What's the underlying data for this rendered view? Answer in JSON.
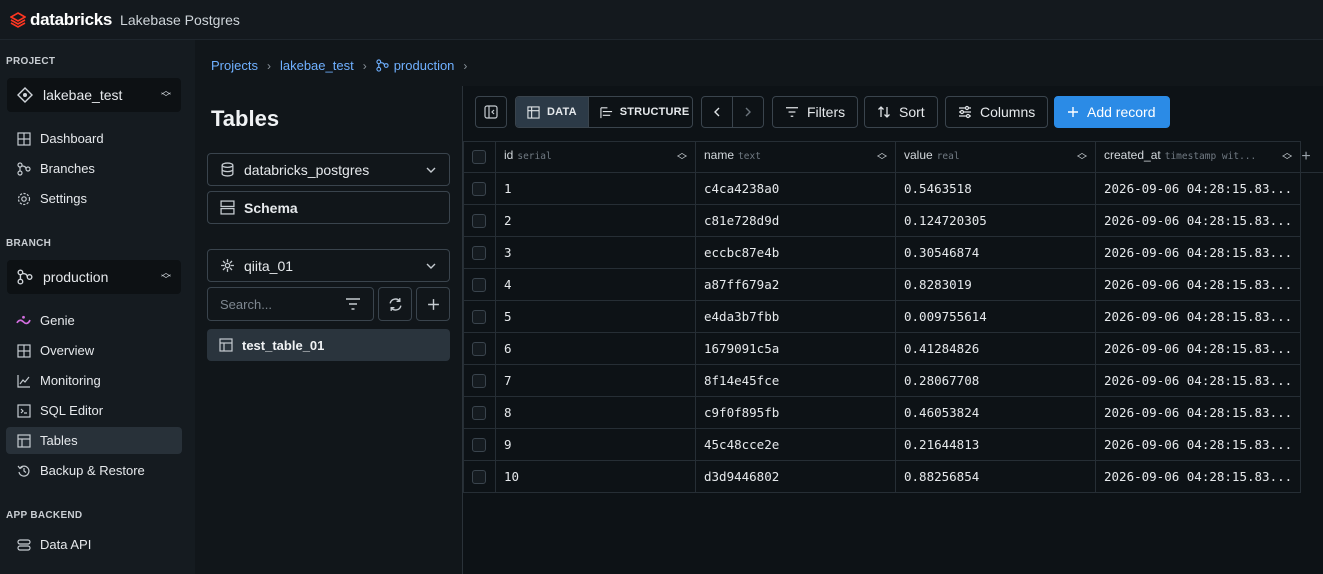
{
  "app": {
    "logo_text": "databricks",
    "product": "Lakebase Postgres"
  },
  "sidebar": {
    "project_heading": "PROJECT",
    "project_name": "lakebae_test",
    "project_items": [
      {
        "label": "Dashboard",
        "icon": "dashboard-icon"
      },
      {
        "label": "Branches",
        "icon": "branch-icon"
      },
      {
        "label": "Settings",
        "icon": "gear-icon"
      }
    ],
    "branch_heading": "BRANCH",
    "branch_name": "production",
    "branch_items": [
      {
        "label": "Genie",
        "icon": "genie-icon"
      },
      {
        "label": "Overview",
        "icon": "overview-icon"
      },
      {
        "label": "Monitoring",
        "icon": "monitoring-icon"
      },
      {
        "label": "SQL Editor",
        "icon": "sql-editor-icon"
      },
      {
        "label": "Tables",
        "icon": "table-icon",
        "active": true
      },
      {
        "label": "Backup & Restore",
        "icon": "backup-icon"
      }
    ],
    "backend_heading": "APP BACKEND",
    "backend_items": [
      {
        "label": "Data API",
        "icon": "data-api-icon"
      }
    ]
  },
  "breadcrumb": [
    "Projects",
    "lakebae_test",
    "production"
  ],
  "tables_panel": {
    "title": "Tables",
    "database": "databricks_postgres",
    "schema_label": "Schema",
    "schema_select": "qiita_01",
    "search_placeholder": "Search...",
    "tables": [
      "test_table_01"
    ]
  },
  "toolbar": {
    "data_tab": "DATA",
    "structure_tab": "STRUCTURE",
    "filters": "Filters",
    "sort": "Sort",
    "columns": "Columns",
    "add_record": "Add record"
  },
  "grid": {
    "columns": [
      {
        "name": "id",
        "type": "serial"
      },
      {
        "name": "name",
        "type": "text"
      },
      {
        "name": "value",
        "type": "real"
      },
      {
        "name": "created_at",
        "type": "timestamp wit..."
      }
    ],
    "rows": [
      [
        "1",
        "c4ca4238a0",
        "0.5463518",
        "2026-09-06 04:28:15.83..."
      ],
      [
        "2",
        "c81e728d9d",
        "0.124720305",
        "2026-09-06 04:28:15.83..."
      ],
      [
        "3",
        "eccbc87e4b",
        "0.30546874",
        "2026-09-06 04:28:15.83..."
      ],
      [
        "4",
        "a87ff679a2",
        "0.8283019",
        "2026-09-06 04:28:15.83..."
      ],
      [
        "5",
        "e4da3b7fbb",
        "0.009755614",
        "2026-09-06 04:28:15.83..."
      ],
      [
        "6",
        "1679091c5a",
        "0.41284826",
        "2026-09-06 04:28:15.83..."
      ],
      [
        "7",
        "8f14e45fce",
        "0.28067708",
        "2026-09-06 04:28:15.83..."
      ],
      [
        "8",
        "c9f0f895fb",
        "0.46053824",
        "2026-09-06 04:28:15.83..."
      ],
      [
        "9",
        "45c48cce2e",
        "0.21644813",
        "2026-09-06 04:28:15.83..."
      ],
      [
        "10",
        "d3d9446802",
        "0.88256854",
        "2026-09-06 04:28:15.83..."
      ]
    ]
  },
  "colors": {
    "accent": "#2b8be6",
    "link": "#6fb0ff",
    "brand": "#ff3621"
  }
}
